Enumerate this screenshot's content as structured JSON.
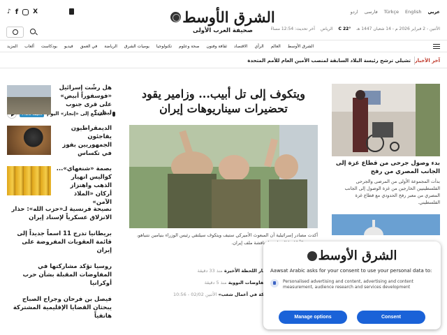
{
  "header": {
    "logo_name": "الشرق الأوسط",
    "logo_tagline": "صحيفة العرب الأولى",
    "languages": [
      "عربي",
      "English",
      "Türkçe",
      "فارسی",
      "اردو"
    ],
    "date": "الأثنين - 2 فبراير 2026 م - 14 شعبان 1447 هـ",
    "temperature": "22° C",
    "city": "الرياض",
    "time_note": "آخر تحديث: 12:54 مساءً"
  },
  "nav": {
    "items": [
      "الشرق الأوسط",
      "العالم",
      "الرأي",
      "الاقتصاد",
      "ثقافة وفنون",
      "صحة وعلوم",
      "تكنولوجيا",
      "يوميات الشرق",
      "الرياضة",
      "في العمق",
      "فيديو",
      "بودكاست",
      "ألعاب",
      "المزيد"
    ]
  },
  "ticker": {
    "label": "آخر الأخبار",
    "text": "تشيلي ترشح رئيسة البلاد السابقة لمنصب الأمين العام للأمم المتحدة"
  },
  "podcast": {
    "title": "استمع إلى «إنجاز» اليوم",
    "duration": "7:28 دقيقة"
  },
  "left_column": [
    {
      "title": "هل رشّت إسرائيل «فوسفوراً أبيض» على قرى جنوب لبنان؟",
      "has_image": true
    },
    {
      "title": "الديمقراطيون يفاجئون الجمهوريين بفوز في تكساس",
      "has_image": true
    },
    {
      "title": "بصمة «شنغهاي»... كواليس انهيار الذهب واهتزاز أركان «الملاذ الآمن»",
      "has_image": true
    },
    {
      "title": "نصيحة فرنسية لـ«حزب الله»: حذار الانزلاق عسكرياً لإسناد إيران",
      "has_image": false
    },
    {
      "title": "بريطانيا تدرج 11 اسماً جديداً إلى قائمة العقوبات المفروضة على إيران",
      "has_image": false
    },
    {
      "title": "روسيا تؤكد مشاركتها في المفاوضات المقبلة بشأن حرب أوكرانيا",
      "has_image": false
    },
    {
      "title": "فيصل بن فرحان وجراح الصباح يبحثان القضايا الإقليمية المشتركة هاتفياً",
      "has_image": false
    }
  ],
  "center": {
    "headline": "ويتكوف إلى تل أبيب... وزامير يقود تحضيرات سيناريوهات إيران",
    "caption": "أكدت مصادر إسرائيلية أن المبعوث الأميركي ستيف ويتكوف سيلتقي رئيس الوزراء بنيامين نتنياهو، ورئيس الأركان إيال زامير لمناقشة ملف إيران.",
    "related": [
      {
        "title": "إسرائيل وإيران أمام اختبار اللحظة الأخيرة",
        "time": "منذ 33 دقيقة"
      },
      {
        "title": "ترمب يلمّح إلى مسار المفاوضات النووية",
        "time": "منذ 5 دقيقة"
      },
      {
        "title": "واشنطن تدرس «المشاركة في أعمال شغب»",
        "time": "الأثنين 02/02 - 10:56"
      }
    ]
  },
  "right_column": {
    "title": "بدء وصول جرحى من قطاع غزة إلى الجانب المصري من رفح",
    "summary": "بدأت المجموعة الأولى من المرضى والجرحى الفلسطينيين الخارجين من غزة الوصول إلى الجانب المصري من معبر رفح الحدودي مع قطاع غزة الفلسطيني."
  },
  "consent": {
    "logo": "الشرق الأوسط",
    "title": "Aawsat Arabic asks for your consent to use your personal data to:",
    "purpose": "Personalised advertising and content, advertising and content measurement, audience research and services development",
    "manage_label": "Manage options",
    "consent_label": "Consent"
  },
  "colors": {
    "accent_red": "#c0392b",
    "consent_blue": "#1a62d8"
  }
}
